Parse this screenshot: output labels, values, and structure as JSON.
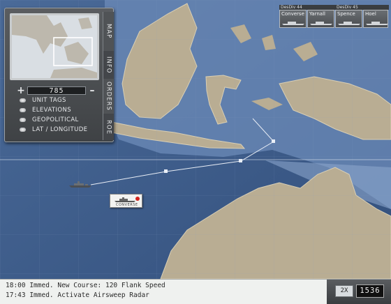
{
  "minimap": {
    "zoom_value": "785",
    "zoom_minus": "+",
    "zoom_plus": "–"
  },
  "map_layers": [
    {
      "label": "UNIT TAGS"
    },
    {
      "label": "ELEVATIONS"
    },
    {
      "label": "GEOPOLITICAL"
    },
    {
      "label": "LAT / LONGITUDE"
    }
  ],
  "tabs": {
    "map": "MAP",
    "info": "INFO",
    "orders": "ORDERS",
    "roe": "ROE"
  },
  "divisions": [
    {
      "name": "DesDiv 44",
      "ships": [
        "Converse",
        "Yarnall"
      ]
    },
    {
      "name": "DesDiv 45",
      "ships": [
        "Spence",
        "Hoel"
      ]
    }
  ],
  "selected_ship": {
    "tag": "CONVERSE"
  },
  "order_log": [
    "18:00 Immed. New Course: 120 Flank Speed",
    "17:43 Immed. Activate Airsweep Radar"
  ],
  "time_control": {
    "speed": "2X",
    "clock": "1536"
  },
  "colors": {
    "ocean_deep": "#3d5a86",
    "ocean_shallow": "#6c8bb8",
    "land": "#b9ad93",
    "panel": "#4a4d50"
  }
}
